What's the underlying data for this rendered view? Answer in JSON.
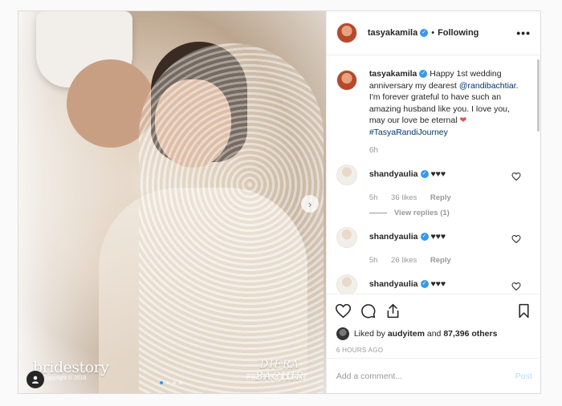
{
  "photo": {
    "brand": "bridestory",
    "brand_sub": "Copyright © 2018",
    "photographer": "DIERA BACHIR",
    "photographer_sub": "PHOTOGRAPHY",
    "next_label": "›"
  },
  "header": {
    "username": "tasyakamila",
    "separator": "•",
    "follow_label": "Following",
    "more_label": "•••"
  },
  "caption": {
    "username": "tasyakamila",
    "text_1": "Happy 1st wedding anniversary my dearest",
    "mention": "@randibachtiar",
    "text_2": ". I'm forever grateful to have such an amazing husband like you. I love you, may our love be eternal",
    "heart": "❤",
    "hashtag": "#TasyaRandiJourney",
    "time": "6h"
  },
  "comments": [
    {
      "username": "shandyaulia",
      "text": "♥♥♥",
      "time": "5h",
      "likes": "36 likes",
      "reply": "Reply",
      "view_replies": "View replies (1)"
    },
    {
      "username": "shandyaulia",
      "text": "♥♥♥",
      "time": "5h",
      "likes": "26 likes",
      "reply": "Reply"
    },
    {
      "username": "shandyaulia",
      "text": "♥♥♥"
    }
  ],
  "likes": {
    "prefix": "Liked by",
    "user": "audyitem",
    "and": "and",
    "count": "87,396 others"
  },
  "timestamp": "6 HOURS AGO",
  "add_comment": {
    "placeholder": "Add a comment...",
    "post_label": "Post"
  },
  "carousel": {
    "slides": 4,
    "current": 1
  },
  "colors": {
    "accent": "#3897f0",
    "heart": "#ed4956",
    "link": "#003569"
  }
}
